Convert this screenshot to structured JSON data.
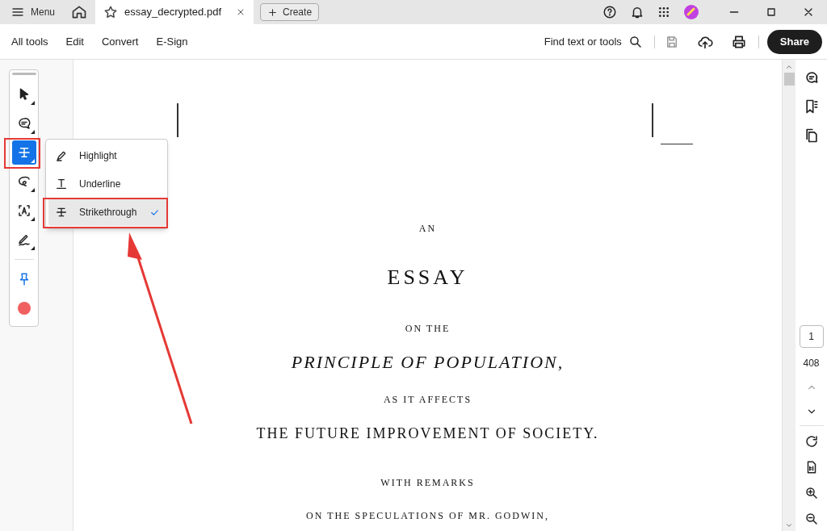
{
  "title_bar": {
    "menu_label": "Menu",
    "tab": {
      "title": "essay_decrypted.pdf"
    },
    "create_button": "Create"
  },
  "toolbar": {
    "menus": [
      "All tools",
      "Edit",
      "Convert",
      "E-Sign"
    ],
    "search_label": "Find text or tools",
    "share_button": "Share"
  },
  "quick_tools": [
    {
      "kind": "select",
      "selected": false
    },
    {
      "kind": "comment",
      "selected": false
    },
    {
      "kind": "strikethrough",
      "selected": true
    },
    {
      "kind": "draw",
      "selected": false
    },
    {
      "kind": "text-select",
      "selected": false
    },
    {
      "kind": "sign",
      "selected": false
    },
    {
      "kind": "pin",
      "selected": false
    },
    {
      "kind": "color",
      "selected": false,
      "color": "#f06060"
    }
  ],
  "markup_menu": [
    {
      "kind": "highlight",
      "label": "Highlight",
      "selected": false
    },
    {
      "kind": "underline",
      "label": "Underline",
      "selected": false
    },
    {
      "kind": "strikethrough",
      "label": "Strikethrough",
      "selected": true
    }
  ],
  "document": {
    "lines": [
      {
        "kind": "small",
        "text": "AN"
      },
      {
        "kind": "title",
        "text": "ESSAY"
      },
      {
        "kind": "small",
        "text": "ON THE"
      },
      {
        "kind": "italic",
        "text": "PRINCIPLE OF POPULATION,"
      },
      {
        "kind": "small",
        "text": "AS IT AFFECTS"
      },
      {
        "kind": "large",
        "text": "THE FUTURE IMPROVEMENT OF SOCIETY."
      },
      {
        "kind": "small",
        "text": "WITH REMARKS"
      },
      {
        "kind": "small",
        "text": "ON THE SPECULATIONS OF MR. GODWIN,"
      }
    ]
  },
  "page_nav": {
    "current_page": "1",
    "total_pages": "408"
  }
}
